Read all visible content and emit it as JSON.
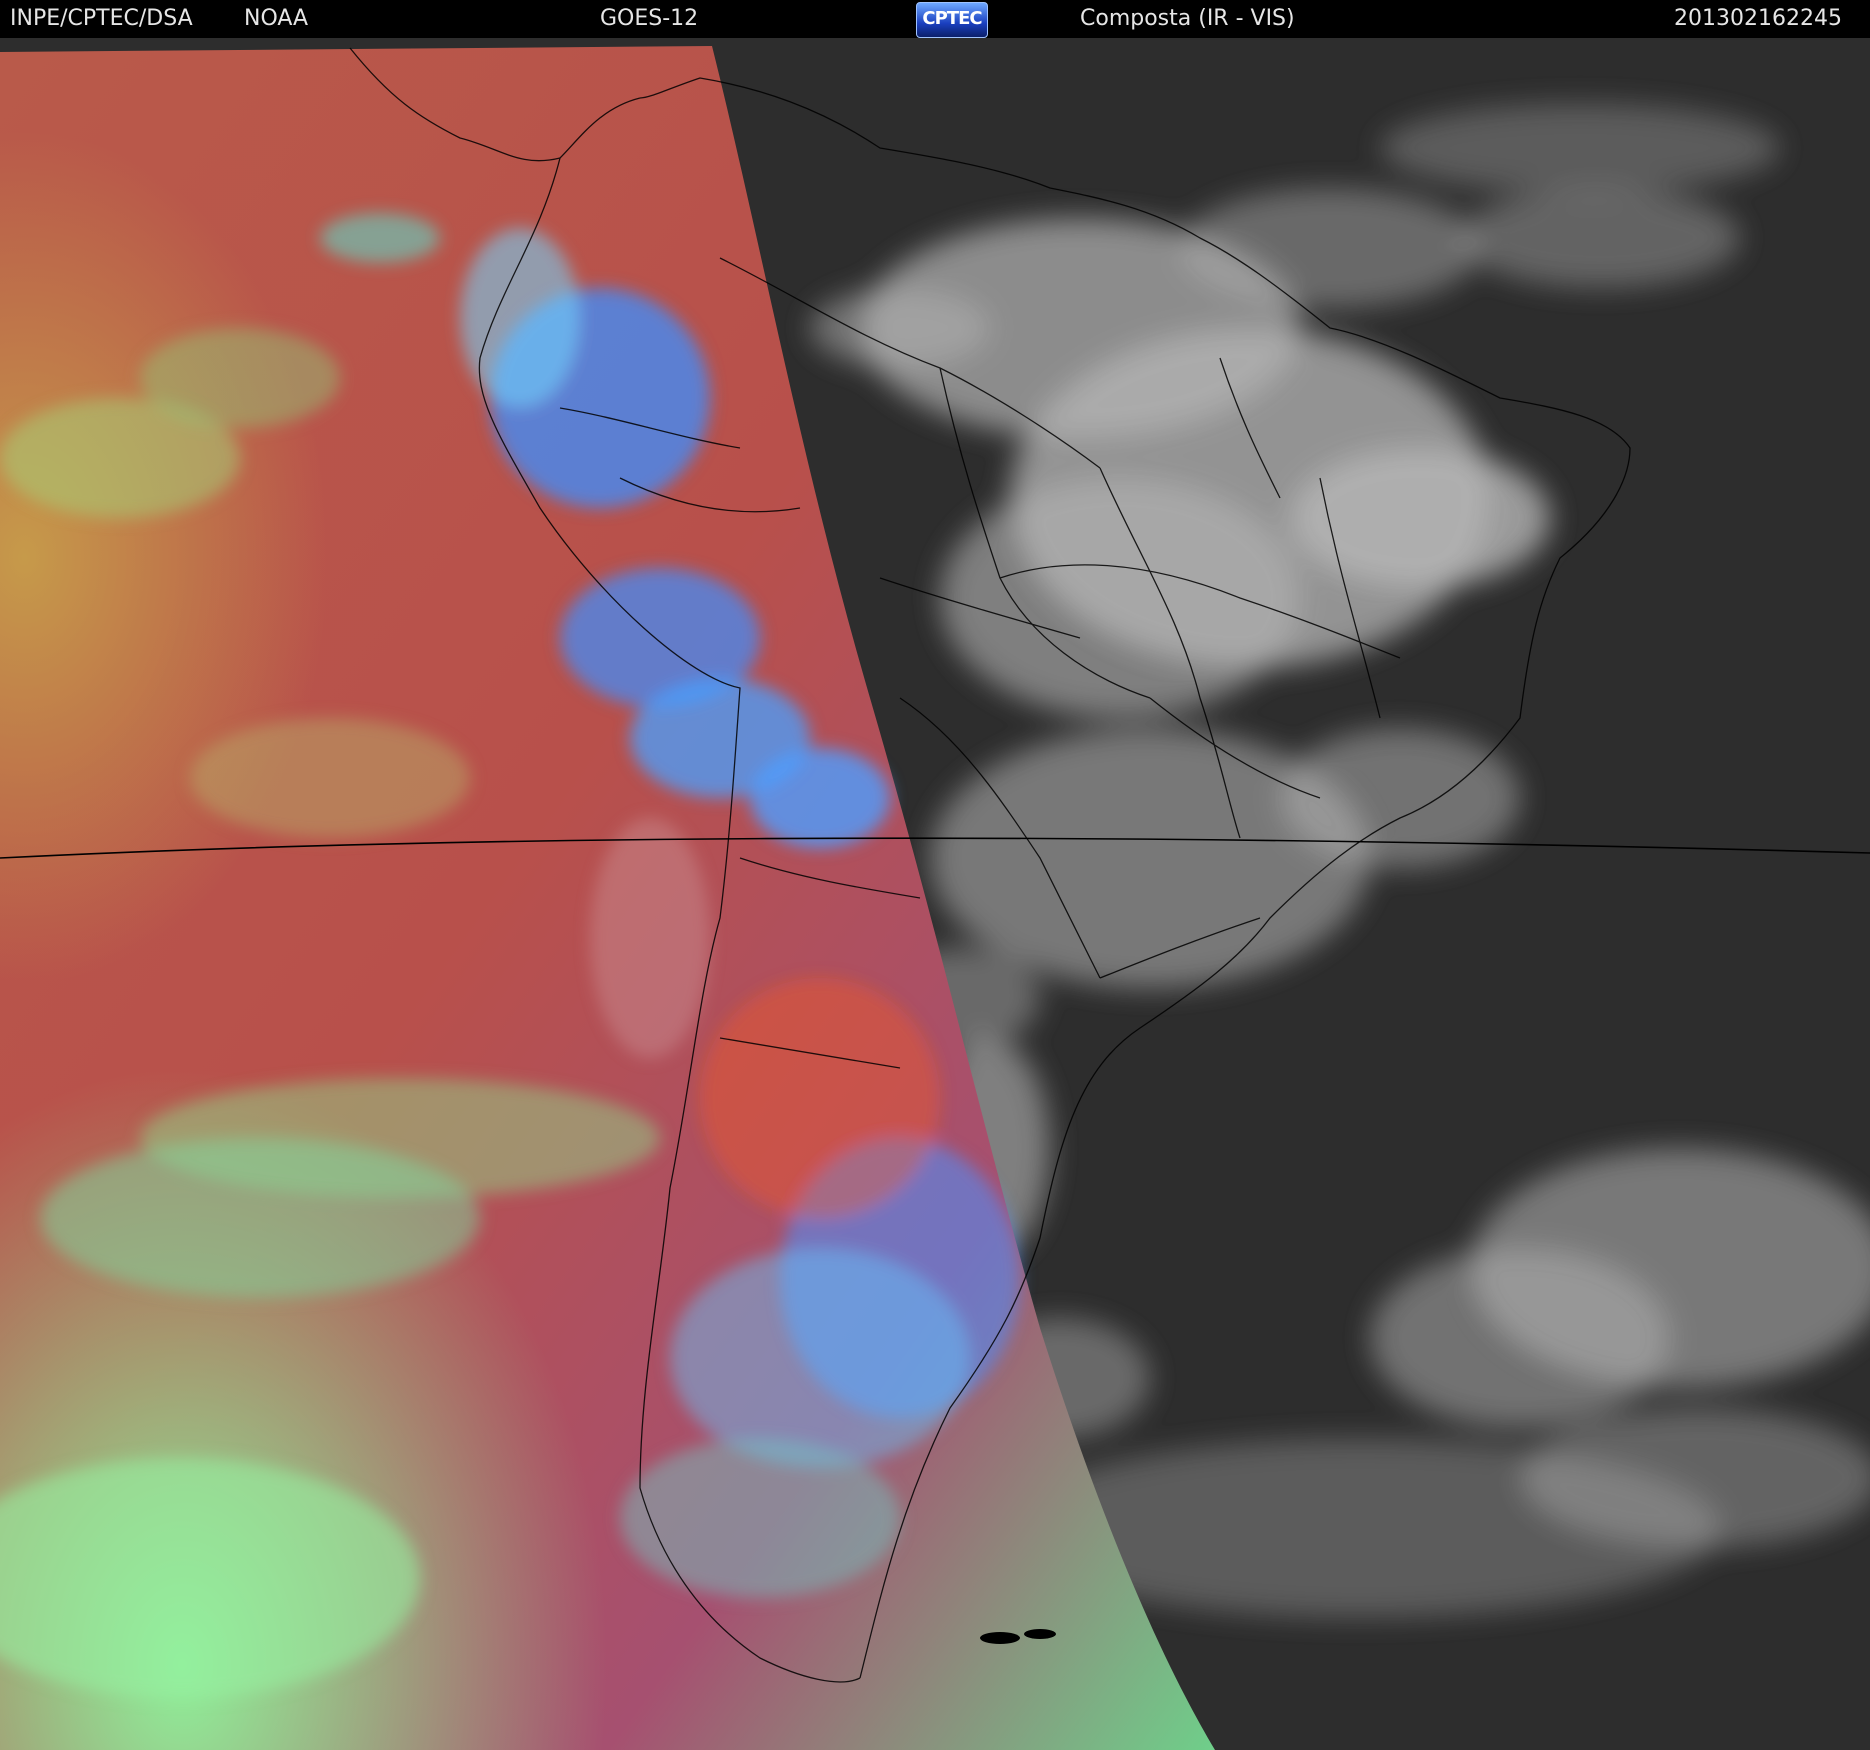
{
  "header": {
    "organization": "INPE/CPTEC/DSA",
    "agency": "NOAA",
    "satellite": "GOES-12",
    "logo_text": "CPTEC",
    "product": "Composta (IR - VIS)",
    "timestamp": "201302162245"
  },
  "colors": {
    "background": "#000000",
    "header_text": "#e6e6e6",
    "ir_ocean": "#b9524a",
    "ir_cloud_cold": "#3f8fff",
    "ir_cloud_low": "#7ee07e",
    "ir_continent": "#c4553b",
    "vis_ocean": "#2b2b2b",
    "vis_cloud": "#d8d8d8",
    "border_lines": "#000000"
  }
}
